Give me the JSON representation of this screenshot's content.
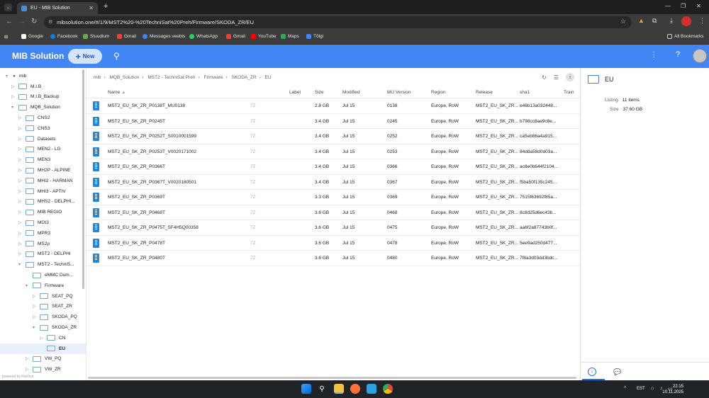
{
  "browser": {
    "tab_title": "EU - MIB Solution",
    "url": "mibsolution.one/#/1/9/MST2%20-%20TechniSat%20Preh/Firmware/SKODA_ZR/EU",
    "bookmarks": [
      "Google",
      "Facebook",
      "Stuudium",
      "Gmail",
      "Messages veebis",
      "WhatsApp",
      "Gmail",
      "YouTube",
      "Maps",
      "Tõlgi"
    ],
    "all_bookmarks": "All Bookmarks"
  },
  "app": {
    "title": "MIB Solution",
    "new_label": "New"
  },
  "sidebar": {
    "root": "mib",
    "items": [
      {
        "label": "M.I.B"
      },
      {
        "label": "M.I.B_Backup"
      },
      {
        "label": "MQB_Solution"
      },
      {
        "label": "CNS2"
      },
      {
        "label": "CNS3"
      },
      {
        "label": "Datasets"
      },
      {
        "label": "MEN2 - LG"
      },
      {
        "label": "MEN3"
      },
      {
        "label": "MH2P - ALPINE"
      },
      {
        "label": "MHI2 - HARMAN"
      },
      {
        "label": "MHI3 - APTIV"
      },
      {
        "label": "MHS2 - DELPHI..."
      },
      {
        "label": "MIB REGIO"
      },
      {
        "label": "MOI3"
      },
      {
        "label": "MPR3"
      },
      {
        "label": "MS2p"
      },
      {
        "label": "MST2 - DELPHI"
      },
      {
        "label": "MST2 - TechniS..."
      },
      {
        "label": "eMMC Dum..."
      },
      {
        "label": "Firmware"
      },
      {
        "label": "SEAT_PQ"
      },
      {
        "label": "SEAT_ZR"
      },
      {
        "label": "SKODA_PQ"
      },
      {
        "label": "SKODA_ZR"
      },
      {
        "label": "CN"
      },
      {
        "label": "EU"
      },
      {
        "label": "VW_PQ"
      },
      {
        "label": "VW_ZR"
      }
    ],
    "powered_by": "powered by FileRun"
  },
  "breadcrumb": [
    "mib",
    "MQB_Solution",
    "MST2 - TechniSat Preh",
    "Firmware",
    "SKODA_ZR",
    "EU"
  ],
  "table": {
    "headers": {
      "name": "Name",
      "label": "Label",
      "size": "Size",
      "modified": "Modified",
      "mu": "MU Version",
      "region": "Region",
      "release": "Release",
      "sha1": "sha1",
      "train": "Train"
    },
    "rows": [
      {
        "name": "MST2_EU_SK_ZR_P0138T_MU0138",
        "label": "7Z",
        "size": "2.8 GB",
        "modified": "Jul 15",
        "mu": "0138",
        "region": "Europe, RoW",
        "release": "MST2_EU_SK_ZR...",
        "sha1": "e46b13a032448..."
      },
      {
        "name": "MST2_EU_SK_ZR_P0245T",
        "label": "7Z",
        "size": "3.4 GB",
        "modified": "Jul 15",
        "mu": "0245",
        "region": "Europe, RoW",
        "release": "MST2_EU_SK_ZR...",
        "sha1": "b798cc8ae9c8e..."
      },
      {
        "name": "MST2_EU_SK_ZR_P0252T_S0010001599",
        "label": "7Z",
        "size": "3.4 GB",
        "modified": "Jul 15",
        "mu": "0252",
        "region": "Europe, RoW",
        "release": "MST2_EU_SK_ZR...",
        "sha1": "ca5eb86a4a915..."
      },
      {
        "name": "MST2_EU_SK_ZR_P0253T_V0020171002",
        "label": "7Z",
        "size": "3.4 GB",
        "modified": "Jul 15",
        "mu": "0253",
        "region": "Europe, RoW",
        "release": "MST2_EU_SK_ZR...",
        "sha1": "84dda58d0d03a..."
      },
      {
        "name": "MST2_EU_SK_ZR_P0366T",
        "label": "7Z",
        "size": "3.4 GB",
        "modified": "Jul 15",
        "mu": "0366",
        "region": "Europe, RoW",
        "release": "MST2_EU_SK_ZR...",
        "sha1": "ac8e0b644f2104..."
      },
      {
        "name": "MST2_EU_SK_ZR_P0367T_V0020180501",
        "label": "7Z",
        "size": "3.4 GB",
        "modified": "Jul 15",
        "mu": "0367",
        "region": "Europe, RoW",
        "release": "MST2_EU_SK_ZR...",
        "sha1": "f5ba50f135c245..."
      },
      {
        "name": "MST2_EU_SK_ZR_P0369T",
        "label": "7Z",
        "size": "3.3 GB",
        "modified": "Jul 15",
        "mu": "0369",
        "region": "Europe, RoW",
        "release": "MST2_EU_SK_ZR...",
        "sha1": "7515f63692f85a..."
      },
      {
        "name": "MST2_EU_SK_ZR_P0468T",
        "label": "7Z",
        "size": "3.6 GB",
        "modified": "Jul 15",
        "mu": "0468",
        "region": "Europe, RoW",
        "release": "MST2_EU_SK_ZR...",
        "sha1": "8c8d25d6ec43b..."
      },
      {
        "name": "MST2_EU_SK_ZR_P0475T_SF4H5Q00358",
        "label": "7Z",
        "size": "3.6 GB",
        "modified": "Jul 15",
        "mu": "0475",
        "region": "Europe, RoW",
        "release": "MST2_EU_SK_ZR...",
        "sha1": "aa6f2a87743b0f..."
      },
      {
        "name": "MST2_EU_SK_ZR_P0478T",
        "label": "7Z",
        "size": "3.6 GB",
        "modified": "Jul 15",
        "mu": "0478",
        "region": "Europe, RoW",
        "release": "MST2_EU_SK_ZR...",
        "sha1": "5ee9ad250d477..."
      },
      {
        "name": "MST2_EU_SK_ZR_P0480T",
        "label": "7Z",
        "size": "3.6 GB",
        "modified": "Jul 15",
        "mu": "0480",
        "region": "Europe, RoW",
        "release": "MST2_EU_SK_ZR...",
        "sha1": "7f8a3d03dd3bdc..."
      }
    ]
  },
  "details": {
    "title": "EU",
    "listing_label": "Listing",
    "listing_value": "11 items",
    "size_label": "Size",
    "size_value": "37.60 GB"
  },
  "taskbar": {
    "lang": "EST",
    "time": "22:15",
    "date": "10.11.2025"
  },
  "colors": {
    "accent": "#4285f4",
    "selected_row": "#e8f0fe",
    "file_icon": "#1e88e5"
  }
}
